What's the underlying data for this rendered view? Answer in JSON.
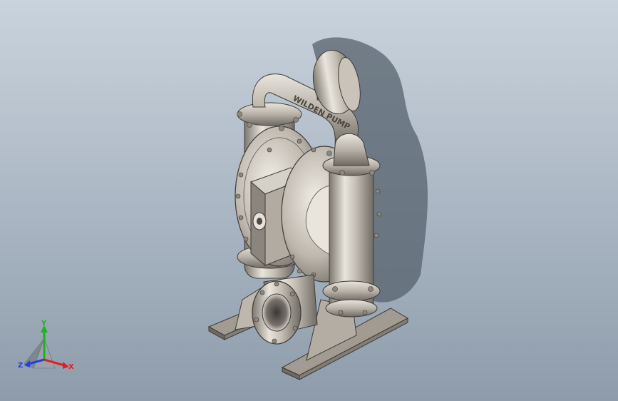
{
  "viewport": {
    "background_top": "#c9d3dd",
    "background_bottom": "#8e9cab"
  },
  "model": {
    "casting_text": "WILDEN PUMP",
    "colors": {
      "metal_light": "#e4e0d8",
      "metal_mid": "#b6b0a6",
      "metal_dark": "#6e6a63",
      "shadow": "#55606b"
    }
  },
  "triad": {
    "x_label": "X",
    "y_label": "Y",
    "z_label": "Z",
    "x_color": "#e02020",
    "y_color": "#20b020",
    "z_color": "#2040e0"
  }
}
